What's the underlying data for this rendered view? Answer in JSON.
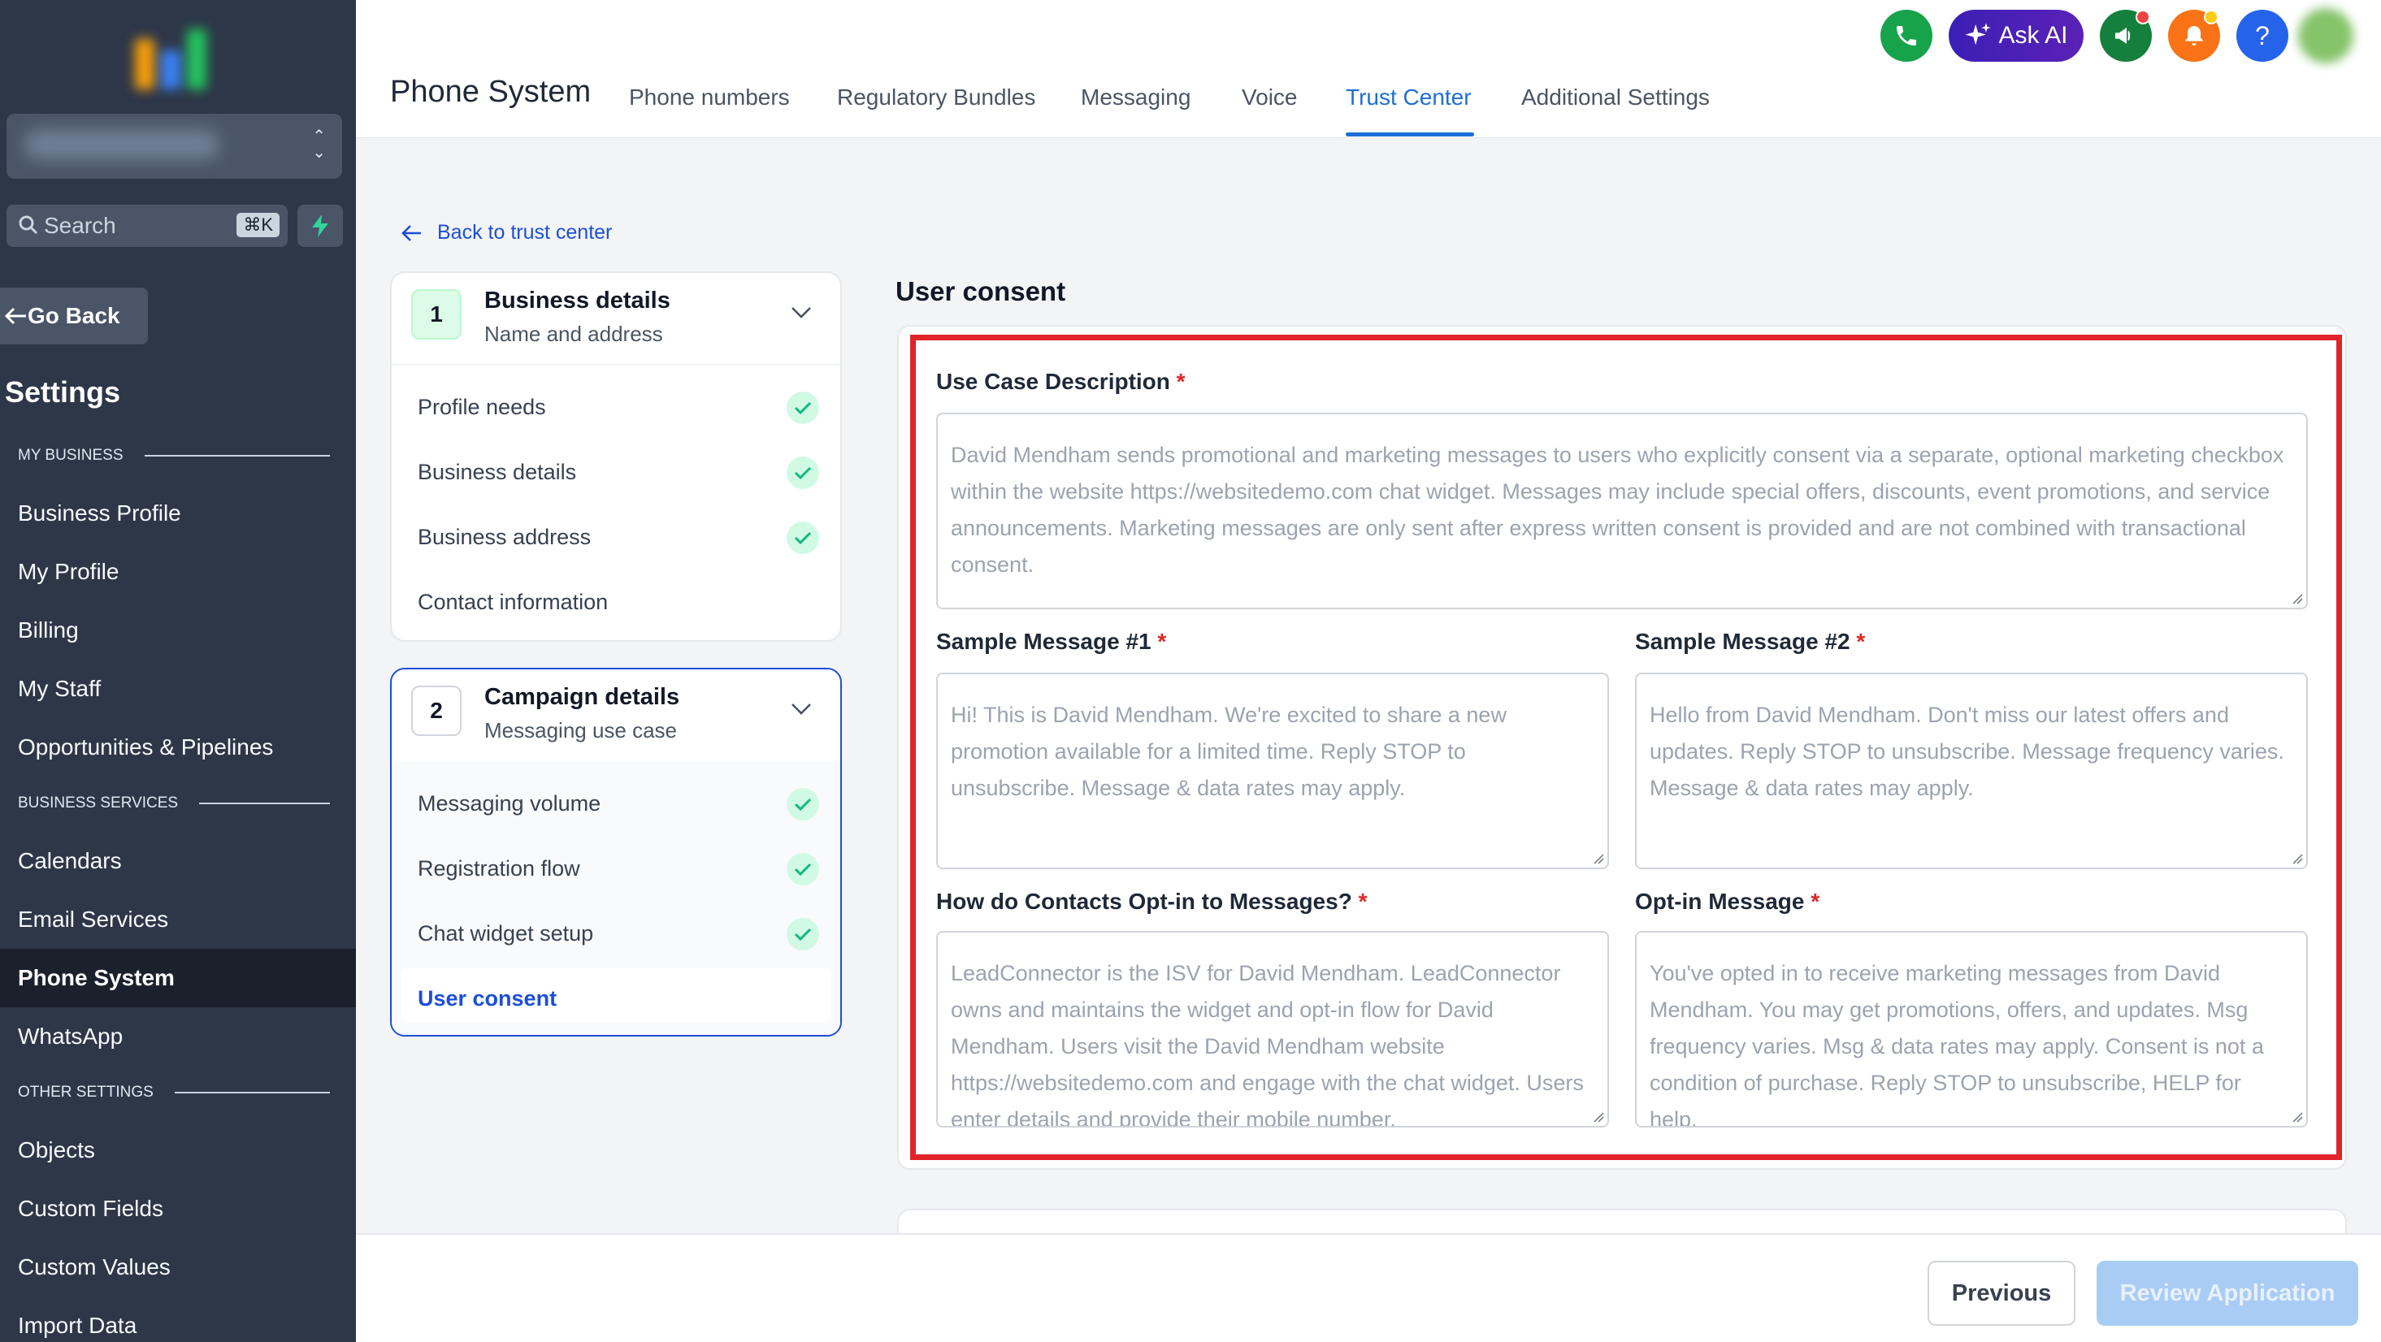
{
  "sidebar": {
    "search_placeholder": "Search",
    "search_shortcut": "⌘K",
    "go_back": "Go Back",
    "title": "Settings",
    "sections": {
      "my_business": "MY BUSINESS",
      "business_services": "BUSINESS SERVICES",
      "other_settings": "OTHER SETTINGS"
    },
    "items": {
      "business_profile": "Business Profile",
      "my_profile": "My Profile",
      "billing": "Billing",
      "my_staff": "My Staff",
      "opportunities": "Opportunities & Pipelines",
      "calendars": "Calendars",
      "email_services": "Email Services",
      "phone_system": "Phone System",
      "whatsapp": "WhatsApp",
      "objects": "Objects",
      "custom_fields": "Custom Fields",
      "custom_values": "Custom Values",
      "import_data": "Import Data"
    },
    "active_item": "Phone System"
  },
  "header": {
    "page_title": "Phone System",
    "tabs": [
      "Phone numbers",
      "Regulatory Bundles",
      "Messaging",
      "Voice",
      "Trust Center",
      "Additional Settings"
    ],
    "active_tab": "Trust Center",
    "ask_ai": "Ask AI",
    "help": "?"
  },
  "back_link": "Back to trust center",
  "steps": [
    {
      "number": "1",
      "title": "Business details",
      "subtitle": "Name and address",
      "items": [
        {
          "label": "Profile needs",
          "done": true
        },
        {
          "label": "Business details",
          "done": true
        },
        {
          "label": "Business address",
          "done": true
        },
        {
          "label": "Contact information",
          "done": false
        }
      ]
    },
    {
      "number": "2",
      "title": "Campaign details",
      "subtitle": "Messaging use case",
      "items": [
        {
          "label": "Messaging volume",
          "done": true
        },
        {
          "label": "Registration flow",
          "done": true
        },
        {
          "label": "Chat widget setup",
          "done": true
        },
        {
          "label": "User consent",
          "done": false,
          "active": true
        }
      ]
    }
  ],
  "form": {
    "section_title": "User consent",
    "use_case": {
      "label": "Use Case Description",
      "required": "*",
      "value": "David Mendham sends promotional and marketing messages to users who explicitly consent via a separate, optional marketing checkbox within the website https://websitedemo.com chat widget. Messages may include special offers, discounts, event promotions, and service announcements. Marketing messages are only sent after express written consent is provided and are not combined with transactional consent."
    },
    "sample1": {
      "label": "Sample Message #1",
      "required": "*",
      "value": "Hi! This is David Mendham. We're excited to share a new promotion available for a limited time. Reply STOP to unsubscribe. Message & data rates may apply."
    },
    "sample2": {
      "label": "Sample Message #2",
      "required": "*",
      "value": "Hello from David Mendham. Don't miss our latest offers and updates. Reply STOP to unsubscribe. Message frequency varies. Message & data rates may apply."
    },
    "optin_how": {
      "label": "How do Contacts Opt-in to Messages?",
      "required": "*",
      "value": "LeadConnector is the ISV for David Mendham. LeadConnector owns and maintains the widget and opt-in flow for David Mendham. Users visit the David Mendham website https://websitedemo.com and engage with the chat widget. Users enter details and provide their mobile number."
    },
    "optin_msg": {
      "label": "Opt-in Message",
      "required": "*",
      "value": "You've opted in to receive marketing messages from David Mendham. You may get promotions, offers, and updates. Msg frequency varies. Msg & data rates may apply. Consent is not a condition of purchase. Reply STOP to unsubscribe, HELP for help."
    }
  },
  "footer": {
    "previous": "Previous",
    "review": "Review Application"
  },
  "colors": {
    "sidebar_bg": "#2d3748",
    "accent": "#1d6fd6",
    "highlight_border": "#e0242a",
    "check_green": "#10b981"
  }
}
